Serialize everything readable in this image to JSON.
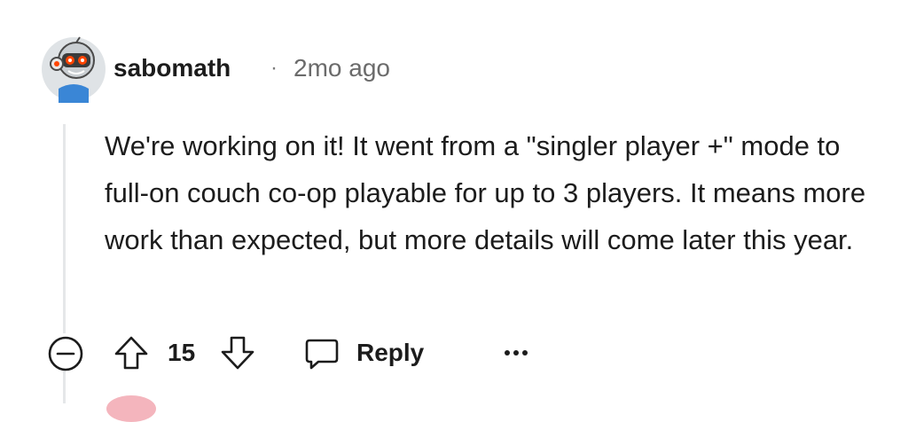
{
  "comment": {
    "author": "sabomath",
    "separator": "·",
    "time_ago": "2mo ago",
    "body": "We're working on it! It went from a \"singler player +\" mode to full-on couch co-op playable for up to 3 players. It means more work than expected, but more details will come later this year.",
    "score": "15",
    "reply_label": "Reply"
  },
  "icons": {
    "collapse": "collapse-icon",
    "upvote": "upvote-arrow-icon",
    "downvote": "downvote-arrow-icon",
    "reply": "comment-bubble-icon",
    "more": "more-options-icon"
  },
  "colors": {
    "text": "#1c1c1c",
    "meta": "#6b6b6b",
    "thread_line": "#e5e7e9",
    "avatar_bg": "#dfe3e6",
    "avatar_body": "#3a86d6",
    "avatar_eyes": "#ff4500"
  }
}
